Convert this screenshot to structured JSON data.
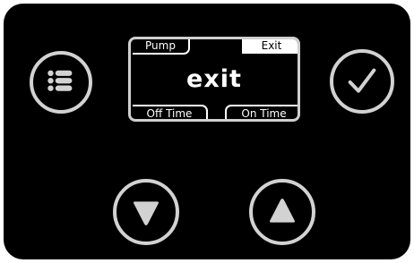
{
  "display": {
    "top_left_tab": "Pump",
    "top_right_tab": "Exit",
    "main_text": "exit",
    "bottom_left_tab": "Off Time",
    "bottom_right_tab": "On Time"
  },
  "buttons": {
    "menu": {
      "icon": "list-menu-icon"
    },
    "confirm": {
      "icon": "checkmark-icon"
    },
    "down": {
      "icon": "triangle-down-icon"
    },
    "up": {
      "icon": "triangle-up-icon"
    }
  },
  "colors": {
    "panel": "#000000",
    "button_ring": "#d2d2d2",
    "screen_border": "#cfcfcf",
    "text": "#ffffff"
  }
}
